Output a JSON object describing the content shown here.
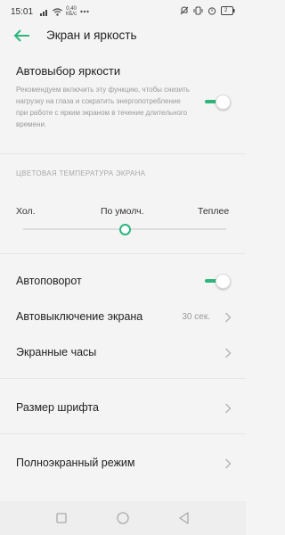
{
  "status_bar": {
    "time": "15:01",
    "net_speed_value": "0,40",
    "net_speed_unit": "КБ/с",
    "battery_level": "2"
  },
  "header": {
    "title": "Экран и яркость"
  },
  "auto_brightness": {
    "title": "Автовыбор яркости",
    "description": "Рекомендуем включить эту функцию, чтобы снизить нагрузку на глаза и сократить энергопотребление при работе с ярким экраном в течение длительного времени.",
    "enabled": true
  },
  "color_temperature": {
    "header": "ЦВЕТОВАЯ ТЕМПЕРАТУРА ЭКРАНА",
    "label_cold": "Хол.",
    "label_default": "По умолч.",
    "label_warm": "Теплее",
    "value_fraction": 0.5
  },
  "settings": {
    "auto_rotate": {
      "label": "Автоповорот",
      "enabled": true
    },
    "screen_timeout": {
      "label": "Автовыключение экрана",
      "value": "30 сек."
    },
    "screen_clock": {
      "label": "Экранные часы"
    },
    "font_size": {
      "label": "Размер шрифта"
    },
    "fullscreen": {
      "label": "Полноэкранный режим"
    }
  },
  "colors": {
    "accent": "#2db67c",
    "background": "#f4f4f4",
    "text_primary": "#222222",
    "text_secondary": "#9a9a9a"
  },
  "nav_bar": {
    "icons": [
      "recents-square-icon",
      "home-circle-icon",
      "back-triangle-icon"
    ]
  }
}
